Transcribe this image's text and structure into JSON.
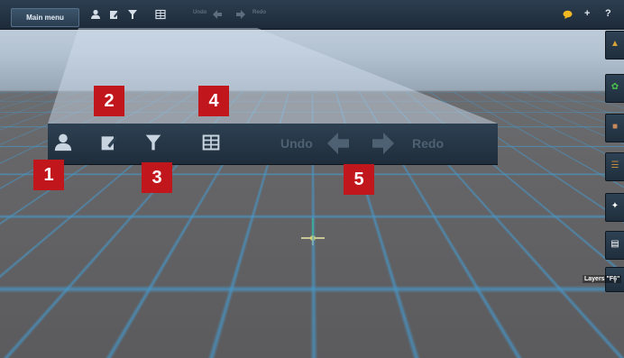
{
  "toolbar": {
    "main_menu_label": "Main menu",
    "undo_label": "Undo",
    "redo_label": "Redo",
    "help_label": "?",
    "add_label": "+"
  },
  "zoom_toolbar": {
    "undo_label": "Undo",
    "redo_label": "Redo"
  },
  "markers": [
    "1",
    "2",
    "3",
    "4",
    "5"
  ],
  "side_panel": {
    "layers_label": "Layers \"F6\""
  },
  "colors": {
    "marker": "#c1171c",
    "toolbar": "#2c3e50",
    "grid_line": "#4696c8"
  },
  "icons": {
    "user": "user-icon",
    "edit": "edit-icon",
    "filter": "filter-icon",
    "table": "table-icon",
    "undo_arrow": "arrow-left-icon",
    "redo_arrow": "arrow-right-icon"
  }
}
